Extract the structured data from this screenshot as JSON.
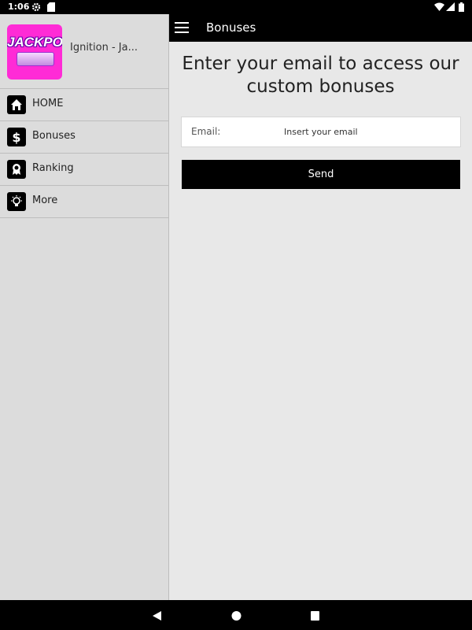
{
  "status_bar": {
    "time": "1:06",
    "icons": [
      "gear-icon",
      "sd-card-icon",
      "wifi-icon",
      "signal-icon",
      "battery-icon"
    ]
  },
  "drawer": {
    "app_name": "Ignition - Ja...",
    "logo_text": "JACKPOT",
    "logo_color": "#ff2bd6",
    "items": [
      {
        "label": "HOME",
        "icon": "home-icon"
      },
      {
        "label": "Bonuses",
        "icon": "dollar-icon"
      },
      {
        "label": "Ranking",
        "icon": "ribbon-icon"
      },
      {
        "label": "More",
        "icon": "lightbulb-icon"
      }
    ]
  },
  "app_bar": {
    "title": "Bonuses"
  },
  "main": {
    "headline": "Enter your email to access our custom bonuses",
    "email_label": "Email:",
    "email_placeholder": "Insert your email",
    "email_value": "",
    "send_label": "Send"
  },
  "nav_bar": {
    "icons": [
      "back-icon",
      "home-circle-icon",
      "recents-icon"
    ]
  }
}
